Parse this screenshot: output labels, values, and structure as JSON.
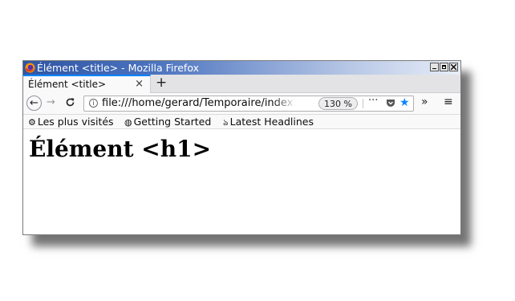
{
  "window": {
    "title": "Élément <title> - Mozilla Firefox"
  },
  "tabs": [
    {
      "label": "Élément <title>",
      "close": "×"
    }
  ],
  "new_tab_label": "+",
  "navbar": {
    "back": "←",
    "forward": "→",
    "reload": "C",
    "url": "file:///home/gerard/Temporaire/index.html",
    "zoom": "130 %",
    "more": "···",
    "overflow": "»",
    "menu": "≡"
  },
  "bookmarks": [
    {
      "icon": "gear-icon",
      "label": "Les plus visités"
    },
    {
      "icon": "globe-icon",
      "label": "Getting Started"
    },
    {
      "icon": "rss-icon",
      "label": "Latest Headlines"
    }
  ],
  "page": {
    "heading": "Élément <h1>"
  },
  "colors": {
    "accent": "#0a84ff",
    "titlebar_start": "#2f55a4",
    "titlebar_end": "#e8eef8"
  }
}
